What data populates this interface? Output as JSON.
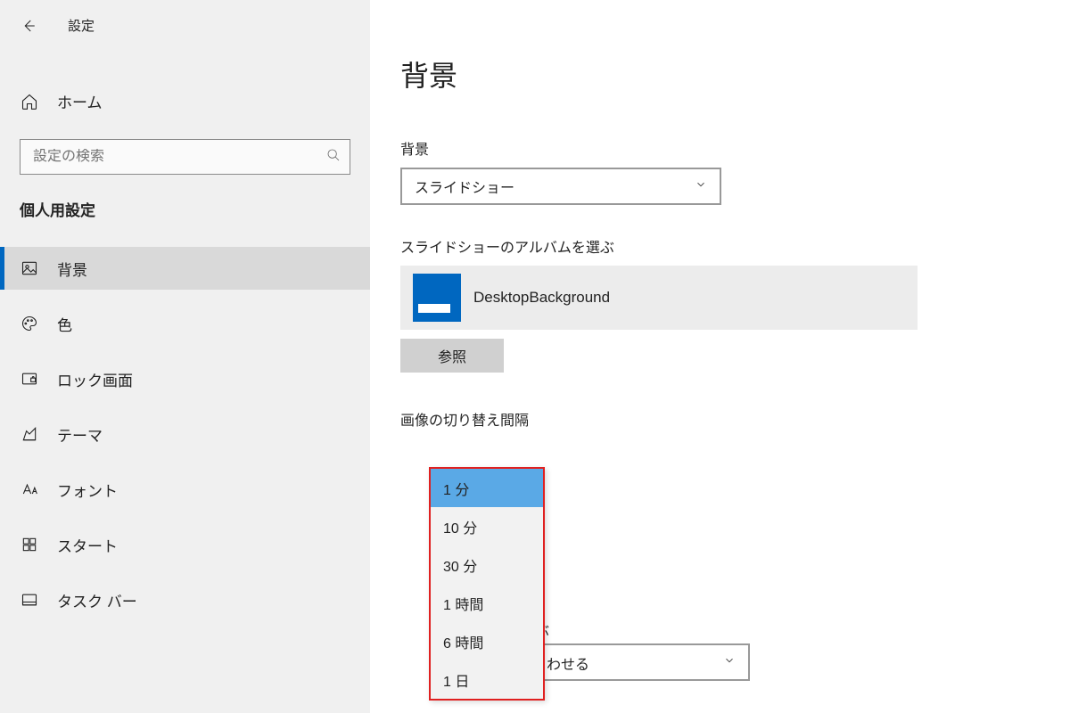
{
  "header": {
    "app_title": "設定"
  },
  "sidebar": {
    "home_label": "ホーム",
    "search_placeholder": "設定の検索",
    "category": "個人用設定",
    "items": [
      {
        "label": "背景"
      },
      {
        "label": "色"
      },
      {
        "label": "ロック画面"
      },
      {
        "label": "テーマ"
      },
      {
        "label": "フォント"
      },
      {
        "label": "スタート"
      },
      {
        "label": "タスク バー"
      }
    ]
  },
  "main": {
    "page_title": "背景",
    "bg_label": "背景",
    "bg_value": "スライドショー",
    "album_label": "スライドショーのアルバムを選ぶ",
    "album_value": "DesktopBackground",
    "browse_label": "参照",
    "interval_label": "画像の切り替え間隔",
    "interval_options": [
      "1 分",
      "10 分",
      "30 分",
      "1 時間",
      "6 時間",
      "1 日"
    ],
    "interval_selected": "1 分",
    "fit_label_partial": "ぶ",
    "fit_value_partial": "わせる"
  }
}
